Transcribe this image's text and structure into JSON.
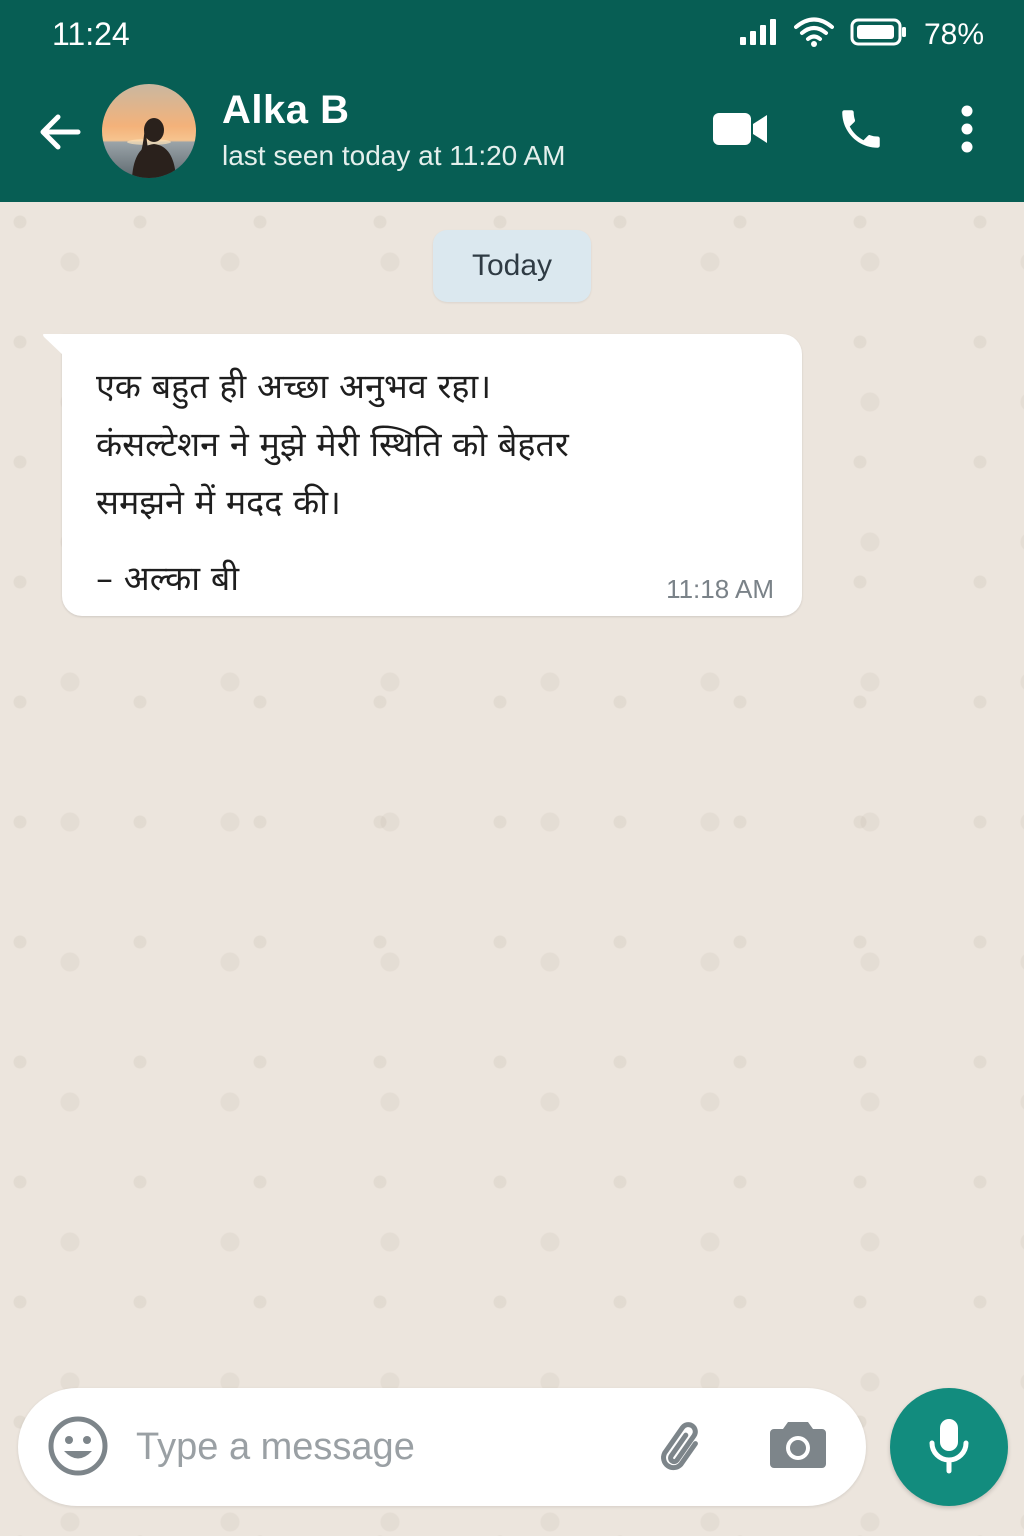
{
  "status_bar": {
    "time": "11:24",
    "battery_percent": "78%",
    "icons": [
      "signal-icon",
      "wifi-icon",
      "battery-icon"
    ]
  },
  "header": {
    "contact_name": "Alka B",
    "contact_status": "last seen today at 11:20 AM",
    "icons": [
      "back-arrow-icon",
      "video-call-icon",
      "phone-icon",
      "more-vertical-icon"
    ]
  },
  "chat": {
    "date_chip": "Today",
    "messages": [
      {
        "lines": [
          "एक बहुत ही अच्छा अनुभव रहा।",
          "कंसल्टेशन ने मुझे मेरी स्थिति को बेहतर",
          "समझने में मदद की।"
        ],
        "signature": "– अल्का बी",
        "time": "11:18 AM"
      }
    ]
  },
  "input_bar": {
    "placeholder": "Type a message",
    "value": "",
    "icons": [
      "emoji-icon",
      "attach-icon",
      "camera-icon",
      "mic-icon"
    ]
  },
  "colors": {
    "header_bg": "#075e54",
    "chat_bg": "#ece5dd",
    "date_chip_bg": "#dbe8ef",
    "bubble_bg": "#ffffff",
    "mic_button_bg": "#128c7e"
  }
}
